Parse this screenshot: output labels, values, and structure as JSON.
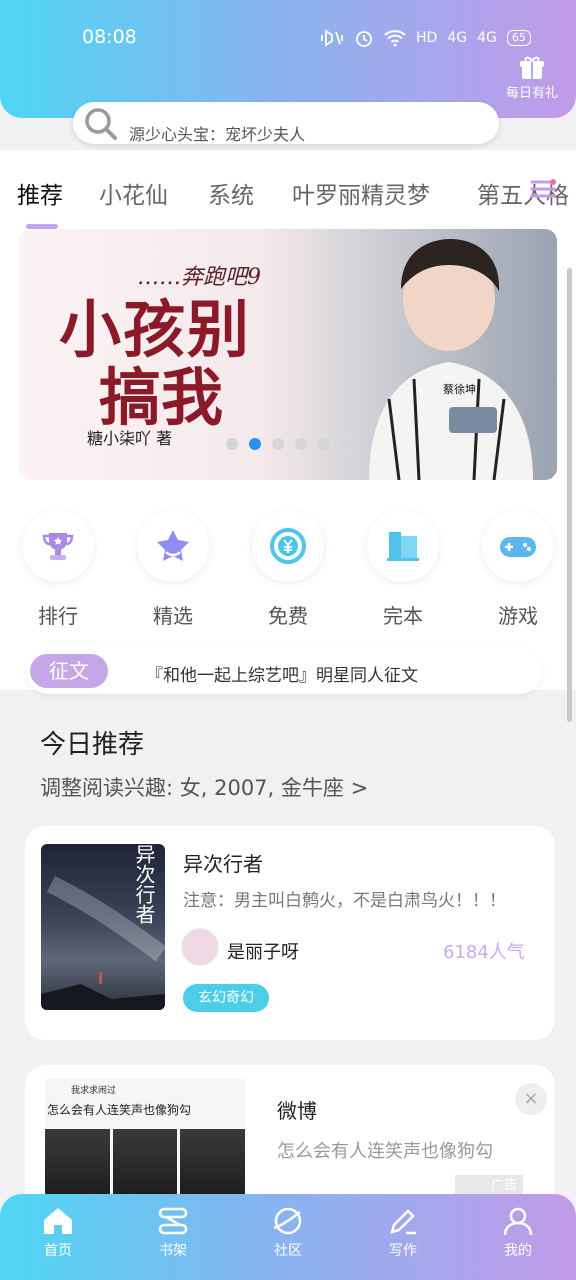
{
  "status_bar": {
    "time": "08:08",
    "network": "HD",
    "signal1": "4G",
    "signal2": "4G",
    "battery": "65"
  },
  "header": {
    "gift_label": "每日有礼",
    "search_placeholder": "源少心头宝：宠坏少夫人"
  },
  "tabs": [
    {
      "label": "推荐",
      "active": true
    },
    {
      "label": "小花仙",
      "active": false
    },
    {
      "label": "系统",
      "active": false
    },
    {
      "label": "叶罗丽精灵梦",
      "active": false
    },
    {
      "label": "第五人格",
      "active": false
    }
  ],
  "banner": {
    "subtitle": "……奔跑吧9",
    "title_line1": "小孩别",
    "title_line2": "搞我",
    "author": "糖小柒吖 著",
    "badge": "蔡徐坤",
    "dots": 6,
    "active_dot": 1
  },
  "categories": [
    {
      "label": "排行",
      "icon": "trophy-icon"
    },
    {
      "label": "精选",
      "icon": "star-icon"
    },
    {
      "label": "免费",
      "icon": "free-yen-icon"
    },
    {
      "label": "完本",
      "icon": "book-icon"
    },
    {
      "label": "游戏",
      "icon": "gamepad-icon"
    }
  ],
  "notice": {
    "tag": "征文",
    "text": "『和他一起上综艺吧』明星同人征文"
  },
  "recommend": {
    "title": "今日推荐",
    "subtitle": "调整阅读兴趣: 女, 2007, 金牛座 >"
  },
  "book": {
    "cover_title": "异次行者",
    "name": "异次行者",
    "desc": "注意：男主叫白鹩火，不是白肃鸟火！！！",
    "author": "是丽子呀",
    "popularity": "6184人气",
    "genre": "玄幻奇幻"
  },
  "ad": {
    "image_header": "怎么会有人连笑声也像狗勾",
    "image_user": "我求求闹过",
    "title": "微博",
    "desc": "怎么会有人连笑声也像狗勾",
    "tag": "广告"
  },
  "bottom_nav": [
    {
      "label": "首页",
      "icon": "home-icon"
    },
    {
      "label": "书架",
      "icon": "bookshelf-icon"
    },
    {
      "label": "社区",
      "icon": "planet-icon"
    },
    {
      "label": "写作",
      "icon": "pen-icon"
    },
    {
      "label": "我的",
      "icon": "user-icon"
    }
  ],
  "colors": {
    "accent_purple": "#c2a4ea",
    "accent_cyan": "#4fd6f3",
    "active_dot": "#2f8cf0"
  }
}
